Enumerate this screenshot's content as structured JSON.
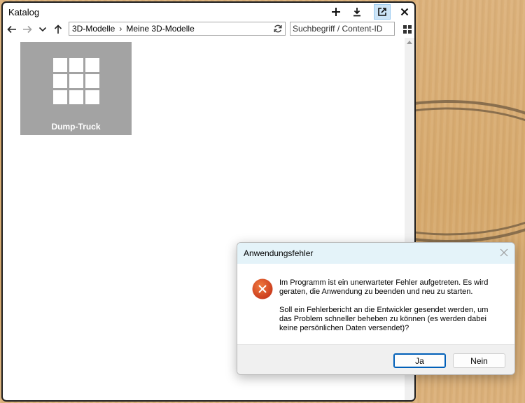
{
  "catalog": {
    "title": "Katalog",
    "breadcrumbs": [
      "3D-Modelle",
      "Meine 3D-Modelle"
    ],
    "search_placeholder": "Suchbegriff / Content-ID",
    "items": [
      {
        "label": "Dump-Truck",
        "icon": "grid-icon"
      }
    ],
    "toolbar_icons": [
      "add-icon",
      "download-icon",
      "popout-icon",
      "close-icon"
    ],
    "nav_icons": [
      "back-arrow-icon",
      "forward-arrow-icon",
      "chevron-down-icon",
      "up-arrow-icon"
    ],
    "tile_color": "#a3a3a3"
  },
  "dialog": {
    "title": "Anwendungsfehler",
    "message1": "Im Programm ist ein unerwarteter Fehler aufgetreten. Es wird geraten, die Anwendung zu beenden und neu zu starten.",
    "message2": "Soll ein Fehlerbericht an die Entwickler gesendet werden, um das Problem schneller beheben zu können (es werden dabei keine persönlichen Daten versendet)?",
    "yes_label": "Ja",
    "no_label": "Nein",
    "icon": "error-icon",
    "accent_color": "#005fb8",
    "error_color": "#d9401e"
  }
}
